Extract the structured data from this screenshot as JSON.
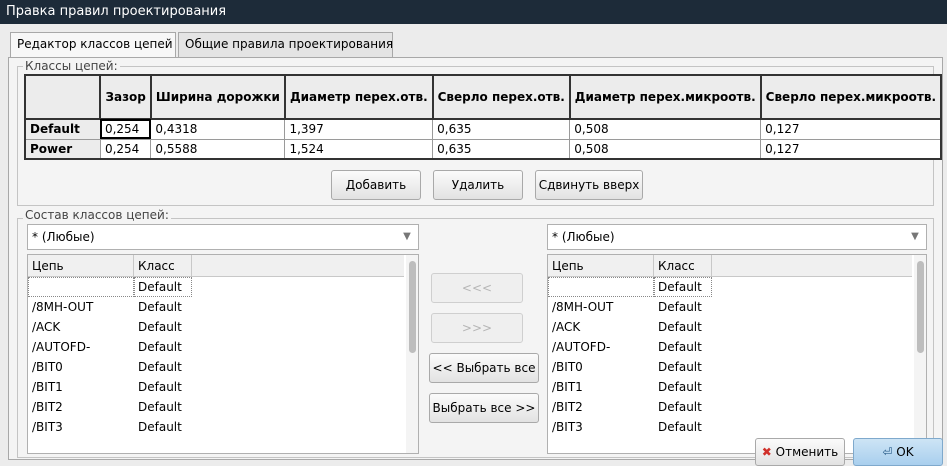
{
  "window": {
    "title": "Правка правил проектирования"
  },
  "tabs": [
    {
      "label": "Редактор классов цепей"
    },
    {
      "label": "Общие правила проектирования"
    }
  ],
  "classes": {
    "group_label": "Классы цепей:",
    "columns": [
      "Зазор",
      "Ширина дорожки",
      "Диаметр перех.отв.",
      "Сверло перех.отв.",
      "Диаметр перех.микроотв.",
      "Сверло перех.микроотв."
    ],
    "rows": [
      {
        "name": "Default",
        "values": [
          "0,254",
          "0,4318",
          "1,397",
          "0,635",
          "0,508",
          "0,127"
        ]
      },
      {
        "name": "Power",
        "values": [
          "0,254",
          "0,5588",
          "1,524",
          "0,635",
          "0,508",
          "0,127"
        ]
      }
    ],
    "buttons": {
      "add": "Добавить",
      "delete": "Удалить",
      "move_up": "Сдвинуть вверх"
    }
  },
  "membership": {
    "group_label": "Состав классов цепей:",
    "left_filter": "* (Любые)",
    "right_filter": "* (Любые)",
    "columns": {
      "net": "Цепь",
      "class": "Класс"
    },
    "left_rows": [
      {
        "net": "",
        "class": "Default"
      },
      {
        "net": "/8MH-OUT",
        "class": "Default"
      },
      {
        "net": "/ACK",
        "class": "Default"
      },
      {
        "net": "/AUTOFD-",
        "class": "Default"
      },
      {
        "net": "/BIT0",
        "class": "Default"
      },
      {
        "net": "/BIT1",
        "class": "Default"
      },
      {
        "net": "/BIT2",
        "class": "Default"
      },
      {
        "net": "/BIT3",
        "class": "Default"
      }
    ],
    "right_rows": [
      {
        "net": "",
        "class": "Default"
      },
      {
        "net": "/8MH-OUT",
        "class": "Default"
      },
      {
        "net": "/ACK",
        "class": "Default"
      },
      {
        "net": "/AUTOFD-",
        "class": "Default"
      },
      {
        "net": "/BIT0",
        "class": "Default"
      },
      {
        "net": "/BIT1",
        "class": "Default"
      },
      {
        "net": "/BIT2",
        "class": "Default"
      },
      {
        "net": "/BIT3",
        "class": "Default"
      }
    ],
    "buttons": {
      "move_left": "<<<",
      "move_right": ">>>",
      "select_all_left": "<< Выбрать все",
      "select_all_right": "Выбрать все >>"
    }
  },
  "footer": {
    "cancel": "Отменить",
    "ok": "OK"
  }
}
